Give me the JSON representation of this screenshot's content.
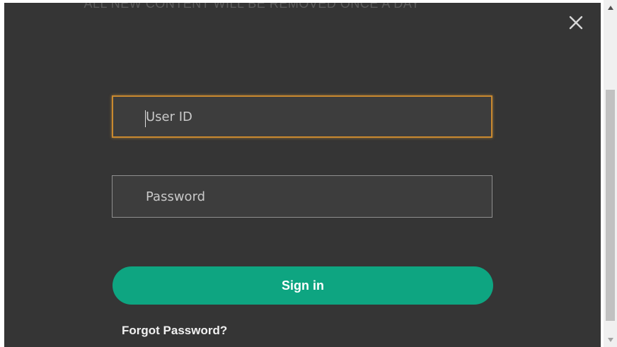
{
  "modal": {
    "banner_text": "ALL NEW CONTENT WILL BE REMOVED ONCE A DAY",
    "close_icon": "close-icon"
  },
  "form": {
    "user_id_placeholder": "User ID",
    "password_placeholder": "Password",
    "signin_label": "Sign in",
    "forgot_label": "Forgot Password?"
  },
  "colors": {
    "modal_bg": "#353535",
    "field_bg": "#3d3d3d",
    "focus_border": "#c9892f",
    "signin_bg": "#0ea581"
  },
  "scrollbar": {
    "up_icon": "scroll-up-icon",
    "down_icon": "scroll-down-icon"
  }
}
